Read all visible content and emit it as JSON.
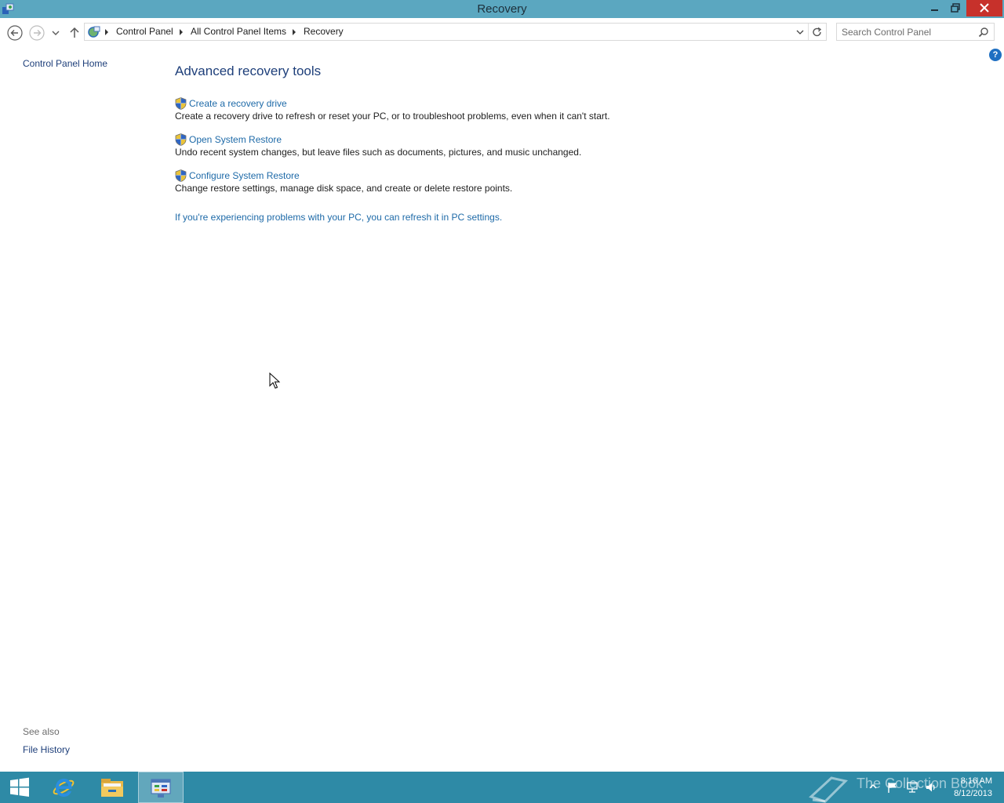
{
  "window": {
    "title": "Recovery",
    "controls": {
      "minimize": "minimize",
      "maximize": "restore",
      "close": "close"
    }
  },
  "navigation": {
    "breadcrumbs": [
      "Control Panel",
      "All Control Panel Items",
      "Recovery"
    ],
    "search_placeholder": "Search Control Panel"
  },
  "left_pane": {
    "home_link": "Control Panel Home",
    "see_also_heading": "See also",
    "see_also_links": [
      "File History"
    ]
  },
  "main": {
    "heading": "Advanced recovery tools",
    "tasks": [
      {
        "link": "Create a recovery drive",
        "description": "Create a recovery drive to refresh or reset your PC, or to troubleshoot problems, even when it can't start."
      },
      {
        "link": "Open System Restore",
        "description": "Undo recent system changes, but leave files such as documents, pictures, and music unchanged."
      },
      {
        "link": "Configure System Restore",
        "description": "Change restore settings, manage disk space, and create or delete restore points."
      }
    ],
    "refresh_link": "If you're experiencing problems with your PC, you can refresh it in PC settings.",
    "help_glyph": "?"
  },
  "taskbar": {
    "pinned": [
      "start-icon",
      "internet-explorer-icon",
      "file-explorer-icon",
      "control-panel-icon"
    ],
    "active_app": "control-panel-icon",
    "watermark": "The Collection Book",
    "clock": {
      "time": "8:16 AM",
      "date": "8/12/2013"
    }
  },
  "colors": {
    "titlebar": "#5ba7c0",
    "taskbar": "#2e8aa6",
    "link": "#1e6aa8",
    "heading": "#1e3f7a",
    "close_button": "#c7312b"
  }
}
